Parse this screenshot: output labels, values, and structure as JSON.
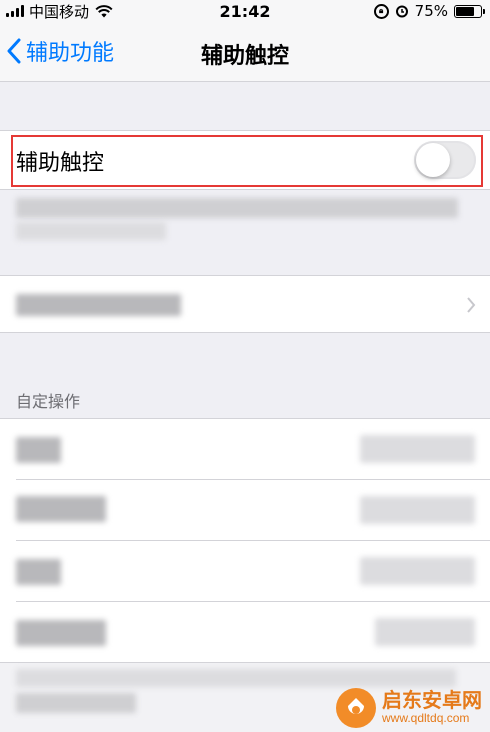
{
  "status_bar": {
    "carrier": "中国移动",
    "time": "21:42",
    "battery": "75%",
    "battery_level": 0.75,
    "icons": [
      "signal-icon",
      "wifi-icon",
      "orientation-lock-icon",
      "alarm-icon",
      "battery-icon"
    ]
  },
  "nav": {
    "back_label": "辅助功能",
    "title": "辅助触控"
  },
  "toggle": {
    "label": "辅助触控",
    "state": "off"
  },
  "section": {
    "custom_actions_header": "自定操作"
  },
  "colors": {
    "accent": "#007aff",
    "highlight": "#e53935",
    "background": "#efeff4"
  },
  "watermark": {
    "name": "启东安卓网",
    "url": "www.qdltdq.com"
  }
}
